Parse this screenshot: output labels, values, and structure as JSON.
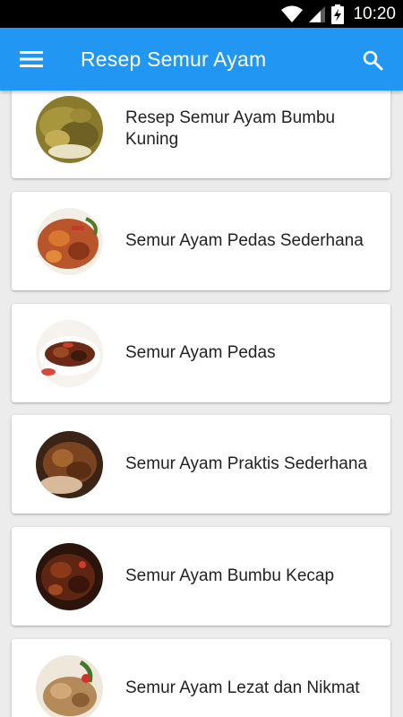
{
  "status_bar": {
    "time": "10:20",
    "icons": [
      "wifi-icon",
      "signal-icon",
      "battery-charging-icon"
    ]
  },
  "app_bar": {
    "title": "Resep Semur Ayam",
    "menu_icon": "hamburger-menu-icon",
    "search_icon": "search-icon"
  },
  "recipes": [
    {
      "title": "Resep Semur Ayam Bumbu Kuning"
    },
    {
      "title": "Semur Ayam Pedas Sederhana"
    },
    {
      "title": "Semur Ayam Pedas"
    },
    {
      "title": "Semur Ayam Praktis Sederhana"
    },
    {
      "title": "Semur Ayam Bumbu Kecap"
    },
    {
      "title": "Semur Ayam Lezat dan Nikmat"
    }
  ],
  "colors": {
    "app_bar": "#2196f3",
    "status_bar": "#000000",
    "background": "#ececec",
    "card": "#ffffff"
  }
}
